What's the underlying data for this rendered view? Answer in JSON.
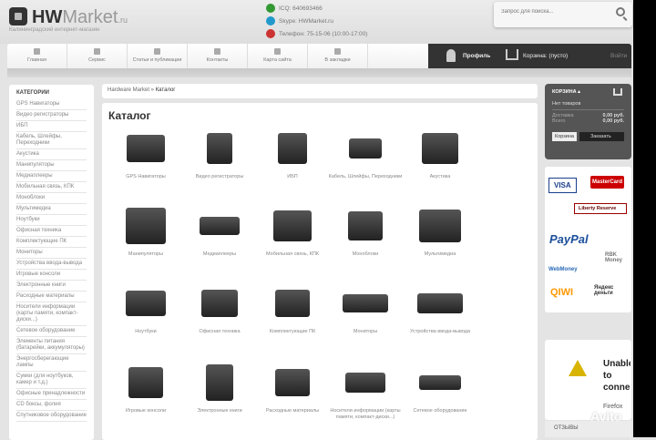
{
  "header": {
    "logo_bold": "HW",
    "logo_rest": "Market",
    "logo_tld": ".ru",
    "tagline": "Калининградский интернет-магазин",
    "icq": "ICQ: 640693466",
    "skype": "Skype: HWMarket.ru",
    "phone": "Телефон: 75-15-06 (10:00-17:00)",
    "search_placeholder": "Запрос для поиска..."
  },
  "nav": {
    "items": [
      "Главная",
      "Сервис",
      "Статьи и публикации",
      "Контакты",
      "Карта сайта",
      "В закладки"
    ],
    "profile": "Профиль",
    "cart": "Корзина: (пусто)",
    "login": "Войти"
  },
  "sidebar": {
    "title": "КАТЕГОРИИ",
    "items": [
      "GPS Навигаторы",
      "Видео регистраторы",
      "ИБП",
      "Кабель, Шлейфы, Переходники",
      "Акустика",
      "Манипуляторы",
      "Медиаплееры",
      "Мобильная связь, КПК",
      "Моноблоки",
      "Мультимедиа",
      "Ноутбуки",
      "Офисная техника",
      "Комплектующие ПК",
      "Мониторы",
      "Устройства ввода-вывода",
      "Игровые консоли",
      "Электронные книги",
      "Расходные материалы",
      "Носители информации (карты памяти, компакт-диски...)",
      "Сетевое оборудование",
      "Элементы питания (батарейки, аккумуляторы)",
      "Энергосберегающие лампы",
      "Сумки (для ноутбуков, камер и т.д.)",
      "Офисные принадлежности",
      "CD боксы, фолия",
      "Спутниковое оборудование"
    ]
  },
  "breadcrumb": {
    "root": "Hardware Market",
    "sep": " » ",
    "current": "Каталог"
  },
  "catalog": {
    "title": "Каталог",
    "products": [
      "GPS Навигаторы",
      "Видео регистраторы",
      "ИБП",
      "Кабель, Шлейфы, Переходники",
      "Акустика",
      "Манипуляторы",
      "Медиаплееры",
      "Мобильная связь, КПК",
      "Моноблоки",
      "Мультимедиа",
      "Ноутбуки",
      "Офисная техника",
      "Комплектующие ПК",
      "Мониторы",
      "Устройства ввода-вывода",
      "Игровые консоли",
      "Электронные книги",
      "Расходные материалы",
      "Носители информации (карты памяти, компакт-диски...)",
      "Сетевое оборудование"
    ]
  },
  "cart": {
    "title": "КОРЗИНА ▴",
    "empty": "Нет товаров",
    "delivery_label": "Доставка",
    "delivery_value": "0,00 руб.",
    "total_label": "Всего",
    "total_value": "0,00 руб.",
    "cart_button": "Корзина",
    "order_button": "Заказать"
  },
  "payments": [
    "VISA",
    "MasterCard",
    "Liberty Reserve",
    "PayPal",
    "RBK Money",
    "WebMoney",
    "QIWI",
    "Яндекс деньги"
  ],
  "error": {
    "title": "Unable to connect",
    "sub": "Firefox"
  },
  "reviews": "ОТЗЫВЫ",
  "watermark": "Avito"
}
